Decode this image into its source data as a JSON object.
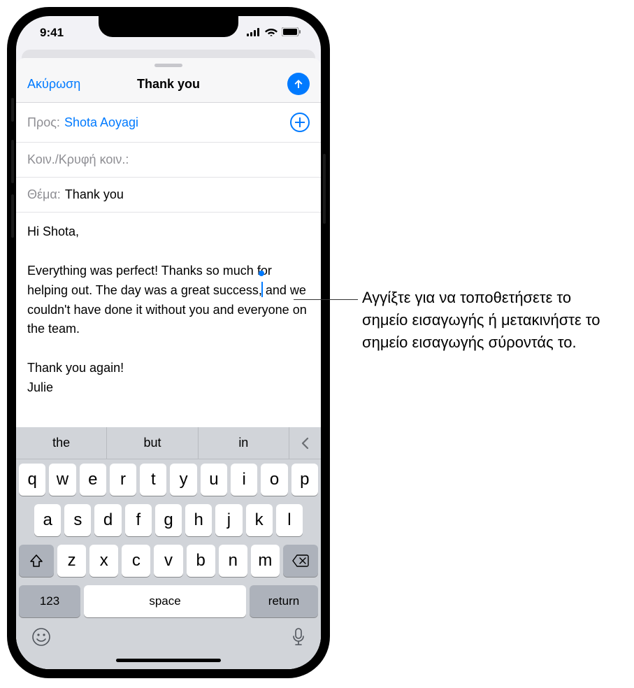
{
  "statusbar": {
    "time": "9:41"
  },
  "nav": {
    "cancel": "Ακύρωση",
    "title": "Thank you"
  },
  "fields": {
    "to_label": "Προς:",
    "to_value": "Shota Aoyagi",
    "ccbcc_label": "Κοιν./Κρυφή κοιν.:",
    "subject_label": "Θέμα:",
    "subject_value": "Thank you"
  },
  "email_body": {
    "greeting": "Hi Shota,",
    "para_before_cursor": "Everything was perfect! Thanks so much for helping out. The day was a great success,",
    "para_after_cursor": " and we couldn't have done it without you and everyone on the team.",
    "thanks": "Thank you again!",
    "signature": "Julie"
  },
  "keyboard": {
    "suggestions": [
      "the",
      "but",
      "in"
    ],
    "row1": [
      "q",
      "w",
      "e",
      "r",
      "t",
      "y",
      "u",
      "i",
      "o",
      "p"
    ],
    "row2": [
      "a",
      "s",
      "d",
      "f",
      "g",
      "h",
      "j",
      "k",
      "l"
    ],
    "row3": [
      "z",
      "x",
      "c",
      "v",
      "b",
      "n",
      "m"
    ],
    "num": "123",
    "space": "space",
    "return": "return"
  },
  "callout": "Αγγίξτε για να τοποθετήσετε το σημείο εισαγωγής ή μετακινήστε το σημείο εισαγωγής σύροντάς το."
}
